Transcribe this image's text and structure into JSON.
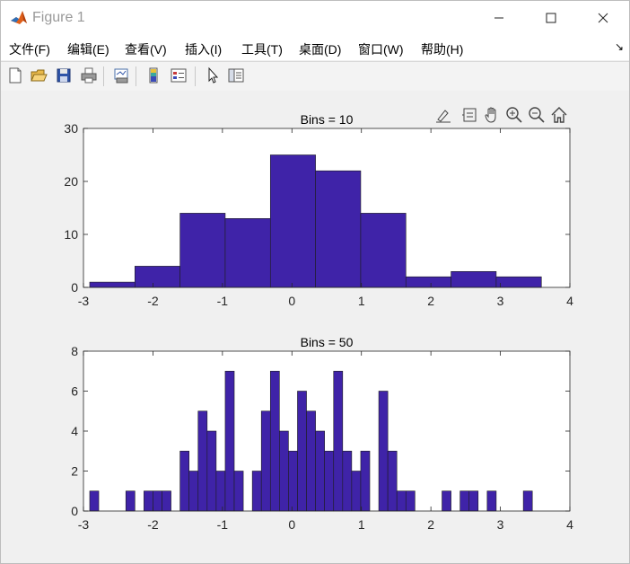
{
  "window": {
    "title": "Figure 1",
    "controls": {
      "minimize": "—",
      "maximize": "☐",
      "close": "✕"
    }
  },
  "menu": {
    "items": [
      "文件(F)",
      "编辑(E)",
      "查看(V)",
      "插入(I)",
      "工具(T)",
      "桌面(D)",
      "窗口(W)",
      "帮助(H)"
    ],
    "dock_arrow": "↘"
  },
  "toolbar": {
    "icons": [
      "new-figure-icon",
      "open-file-icon",
      "save-icon",
      "print-icon",
      "link-plot-icon",
      "insert-colorbar-icon",
      "insert-legend-icon",
      "edit-plot-arrow-icon",
      "property-inspector-icon"
    ]
  },
  "axes_toolbar": {
    "icons": [
      "brush-icon",
      "data-tips-icon",
      "pan-hand-icon",
      "zoom-in-icon",
      "zoom-out-icon",
      "restore-view-home-icon"
    ]
  },
  "colors": {
    "bar_fill": "#3f23a8",
    "bar_edge": "#1e1e1e",
    "axes_bg": "#ffffff",
    "figure_bg": "#f0f0f0"
  },
  "chart_data": [
    {
      "type": "bar",
      "title": "Bins = 10",
      "xlabel": "",
      "ylabel": "",
      "xlim": [
        -3,
        4
      ],
      "ylim": [
        0,
        30
      ],
      "xticks": [
        -3,
        -2,
        -1,
        0,
        1,
        2,
        3,
        4
      ],
      "yticks": [
        0,
        10,
        20,
        30
      ],
      "grid": false,
      "bin_edges": [
        -2.91,
        -2.26,
        -1.61,
        -0.96,
        -0.31,
        0.34,
        0.99,
        1.64,
        2.29,
        2.94,
        3.59
      ],
      "values": [
        1,
        4,
        14,
        13,
        25,
        22,
        14,
        2,
        3,
        2
      ]
    },
    {
      "type": "bar",
      "title": "Bins = 50",
      "xlabel": "",
      "ylabel": "",
      "xlim": [
        -3,
        4
      ],
      "ylim": [
        0,
        8
      ],
      "xticks": [
        -3,
        -2,
        -1,
        0,
        1,
        2,
        3,
        4
      ],
      "yticks": [
        0,
        2,
        4,
        6,
        8
      ],
      "grid": false,
      "bin_start": -2.91,
      "bin_width": 0.13,
      "values": [
        1,
        0,
        0,
        0,
        1,
        0,
        1,
        1,
        1,
        0,
        3,
        2,
        5,
        4,
        2,
        7,
        2,
        0,
        2,
        5,
        7,
        4,
        3,
        6,
        5,
        4,
        3,
        7,
        3,
        2,
        3,
        0,
        6,
        3,
        1,
        1,
        0,
        0,
        0,
        1,
        0,
        1,
        1,
        0,
        1,
        0,
        0,
        0,
        1,
        0
      ]
    }
  ]
}
